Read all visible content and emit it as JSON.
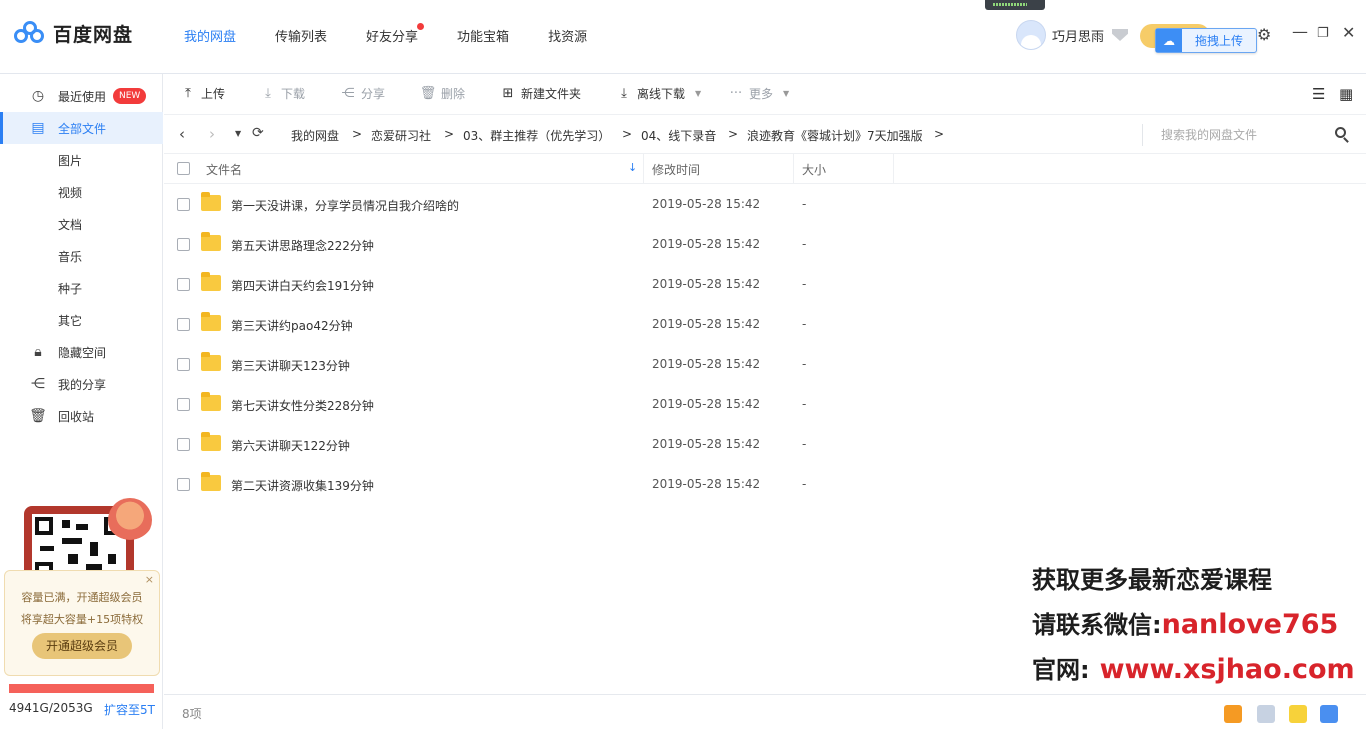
{
  "app": {
    "name": "百度网盘"
  },
  "nav": [
    {
      "label": "我的网盘",
      "active": true
    },
    {
      "label": "传输列表"
    },
    {
      "label": "好友分享",
      "dot": true
    },
    {
      "label": "功能宝箱"
    },
    {
      "label": "找资源"
    }
  ],
  "user": {
    "name": "巧月思雨"
  },
  "drag_upload": {
    "label": "拖拽上传"
  },
  "sidebar": {
    "items": [
      {
        "label": "最近使用",
        "badge": "NEW",
        "icon": "clock-icon"
      },
      {
        "label": "全部文件",
        "icon": "file-icon",
        "active": true
      },
      {
        "label": "图片"
      },
      {
        "label": "视频"
      },
      {
        "label": "文档"
      },
      {
        "label": "音乐"
      },
      {
        "label": "种子"
      },
      {
        "label": "其它"
      },
      {
        "label": "隐藏空间",
        "icon": "lock-icon"
      },
      {
        "label": "我的分享",
        "icon": "share-icon"
      },
      {
        "label": "回收站",
        "icon": "trash-icon"
      }
    ],
    "promo": {
      "line1": "容量已满，开通超级会员",
      "line2": "将享超大容量+15项特权",
      "button": "开通超级会员",
      "close": "×"
    },
    "quota": {
      "text": "4941G/2053G",
      "used_fraction": 1.0
    },
    "expand": "扩容至5T"
  },
  "toolbar": {
    "upload": "上传",
    "download": "下载",
    "share": "分享",
    "delete": "删除",
    "new_folder": "新建文件夹",
    "offline_download": "离线下载",
    "more": "更多"
  },
  "breadcrumb": [
    "我的网盘",
    "恋爱研习社",
    "03、群主推荐（优先学习）",
    "04、线下录音",
    "浪迹教育《蓉城计划》7天加强版"
  ],
  "search": {
    "placeholder": "搜索我的网盘文件"
  },
  "table": {
    "headers": {
      "name": "文件名",
      "modified": "修改时间",
      "size": "大小"
    },
    "rows": [
      {
        "name": "第一天没讲课，分享学员情况自我介绍啥的",
        "modified": "2019-05-28 15:42",
        "size": "-"
      },
      {
        "name": "第五天讲思路理念222分钟",
        "modified": "2019-05-28 15:42",
        "size": "-"
      },
      {
        "name": "第四天讲白天约会191分钟",
        "modified": "2019-05-28 15:42",
        "size": "-"
      },
      {
        "name": "第三天讲约pao42分钟",
        "modified": "2019-05-28 15:42",
        "size": "-"
      },
      {
        "name": "第三天讲聊天123分钟",
        "modified": "2019-05-28 15:42",
        "size": "-"
      },
      {
        "name": "第七天讲女性分类228分钟",
        "modified": "2019-05-28 15:42",
        "size": "-"
      },
      {
        "name": "第六天讲聊天122分钟",
        "modified": "2019-05-28 15:42",
        "size": "-"
      },
      {
        "name": "第二天讲资源收集139分钟",
        "modified": "2019-05-28 15:42",
        "size": "-"
      }
    ]
  },
  "status": {
    "count": "8项"
  },
  "watermark": {
    "line1": "获取更多最新恋爱课程",
    "line2_label": "请联系微信:",
    "line2_value": "nanlove765",
    "line3_label": "官网:",
    "line3_value": "www.xsjhao.com"
  },
  "colors": {
    "accent": "#2b7ff3",
    "folder": "#f9c93f",
    "danger": "#f23b3b",
    "watermark_red": "#d8242b"
  }
}
